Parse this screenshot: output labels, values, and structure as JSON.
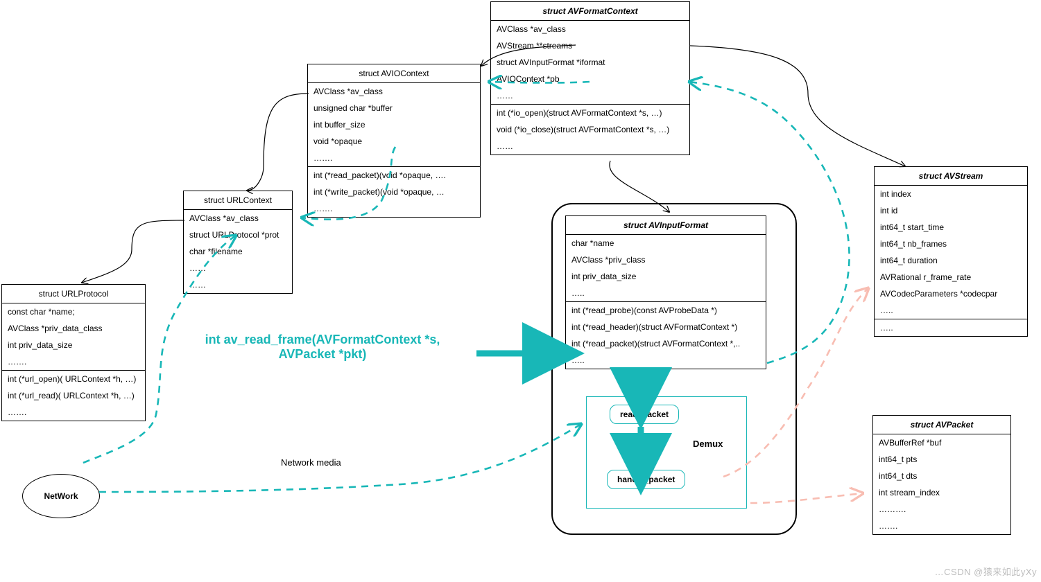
{
  "node": {
    "fmt": {
      "title": "struct AVFormatContext",
      "sec1": [
        "AVClass *av_class",
        "AVStream **streams",
        "struct AVInputFormat *iformat",
        "AVIOContext *pb",
        "……"
      ],
      "sec2": [
        "int (*io_open)(struct AVFormatContext *s, …)",
        "void (*io_close)(struct AVFormatContext *s, …)",
        "……"
      ]
    },
    "avio": {
      "title": "struct AVIOContext",
      "sec1": [
        "AVClass *av_class",
        "unsigned char *buffer",
        "int buffer_size",
        "void *opaque",
        "……."
      ],
      "sec2": [
        "int (*read_packet)(void *opaque, ….",
        "int (*write_packet)(void *opaque, …",
        "……."
      ]
    },
    "urlctx": {
      "title": "struct URLContext",
      "sec1": [
        "AVClass *av_class",
        "struct URLProtocol *prot",
        "char *filename",
        "……",
        "……"
      ]
    },
    "urlproto": {
      "title": "struct URLProtocol",
      "sec1": [
        "const char *name;",
        "AVClass *priv_data_class",
        "int priv_data_size",
        "……."
      ],
      "sec2": [
        "int (*url_open)( URLContext *h, …)",
        "int (*url_read)( URLContext *h, …)",
        "……."
      ]
    },
    "inputfmt": {
      "title": "struct AVInputFormat",
      "sec1": [
        "char *name",
        "AVClass *priv_class",
        "int priv_data_size",
        "….."
      ],
      "sec2": [
        "int (*read_probe)(const AVProbeData *)",
        "int (*read_header)(struct AVFormatContext *)",
        "int (*read_packet)(struct AVFormatContext *,..",
        "….."
      ]
    },
    "stream": {
      "title": "struct AVStream",
      "sec1": [
        "int index",
        "int id",
        "int64_t start_time",
        " int64_t nb_frames",
        "int64_t duration",
        "AVRational r_frame_rate",
        "AVCodecParameters *codecpar",
        "….."
      ],
      "sec2": [
        "….."
      ]
    },
    "packet": {
      "title": "struct AVPacket",
      "sec1": [
        "AVBufferRef *buf",
        "int64_t pts",
        "int64_t dts",
        "int   stream_index",
        "……….",
        "……."
      ]
    }
  },
  "pill": {
    "read": "read_packet",
    "handle": "handle_packet"
  },
  "label": {
    "demux": "Demux",
    "netmedia": "Network media",
    "network": "NetWork"
  },
  "call": {
    "l1": "int av_read_frame(AVFormatContext *s,",
    "l2": "AVPacket *pkt)"
  },
  "wm": "…CSDN @猿来如此yXy"
}
